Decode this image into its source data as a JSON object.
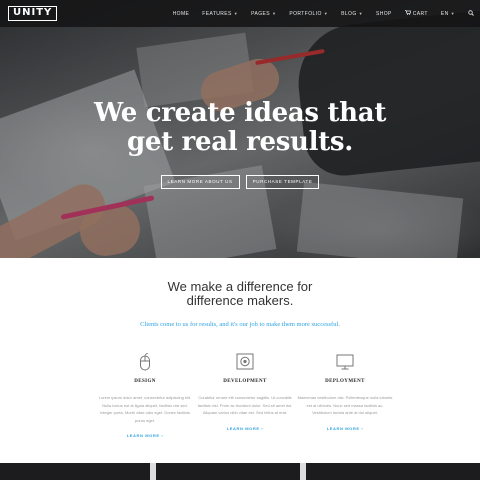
{
  "brand": {
    "logo": "UNITY"
  },
  "nav": {
    "items": [
      {
        "label": "HOME",
        "caret": false
      },
      {
        "label": "FEATURES",
        "caret": true
      },
      {
        "label": "PAGES",
        "caret": true
      },
      {
        "label": "PORTFOLIO",
        "caret": true
      },
      {
        "label": "BLOG",
        "caret": true
      },
      {
        "label": "SHOP",
        "caret": false
      }
    ],
    "cart_label": "CART",
    "language": "EN",
    "icons": [
      "cart-icon",
      "search-icon"
    ]
  },
  "hero": {
    "headline_line1": "We create ideas that",
    "headline_line2": "get real results.",
    "button_primary": "LEARN MORE ABOUT US",
    "button_secondary": "PURCHASE TEMPLATE"
  },
  "intro": {
    "title_line1": "We make a difference for",
    "title_line2": "difference makers.",
    "subtitle": "Clients come to us for results, and it's our job to make them more successful."
  },
  "features": [
    {
      "icon": "mouse-icon",
      "title": "DESIGN",
      "text": "Lorem ipsum dolor amet, consectetur adipiscing elit. Nulla luctus est at ligula aliquet, facilisis nisi sed. Integer porta. Morbi vitae odio eget. Donec facilisis purus eget.",
      "link": "LEARN MORE"
    },
    {
      "icon": "monitor-settings-icon",
      "title": "DEVELOPMENT",
      "text": "Curabitur ornare elit consectetur sagittis. Ut convallis facilisis nisl. Proin ac tincidunt dolor. Sed sit amet dui. Aliquam varius nibh vitae est. Sed tellus at erat.",
      "link": "LEARN MORE"
    },
    {
      "icon": "monitor-icon",
      "title": "DEPLOYMENT",
      "text": "Maecenas vestibulum nisl. Pellentesque nulla lobortis est at ultricies. Nunc sed massa facilisis ac. Vestibulum lacinia ante at dui aliquet.",
      "link": "LEARN MORE"
    }
  ],
  "colors": {
    "accent": "#2ea3e0",
    "nav_background": "#141416",
    "heading_text": "#333333",
    "body_text": "#9a9a9a"
  }
}
